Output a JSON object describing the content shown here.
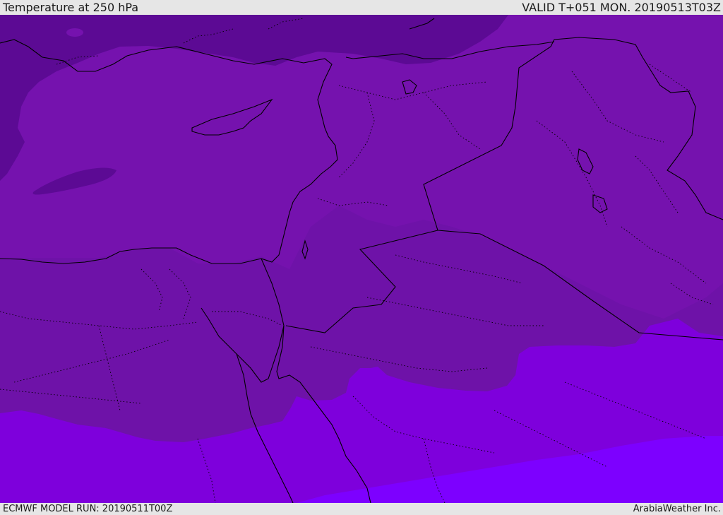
{
  "header": {
    "title": "Temperature at 250 hPa",
    "valid": "VALID T+051 MON. 20190513T03Z"
  },
  "footer": {
    "model_run": "ECMWF MODEL RUN: 20190511T00Z",
    "brand": "ArabiaWeather Inc."
  },
  "map": {
    "variable": "temperature-250hPa",
    "colors": {
      "deep_purple": "#5c0a94",
      "purple": "#6e12a8",
      "base_purple": "#7512ae",
      "violet": "#7e00dc",
      "bright_violet": "#7d00ff",
      "border_line": "#000000"
    }
  }
}
